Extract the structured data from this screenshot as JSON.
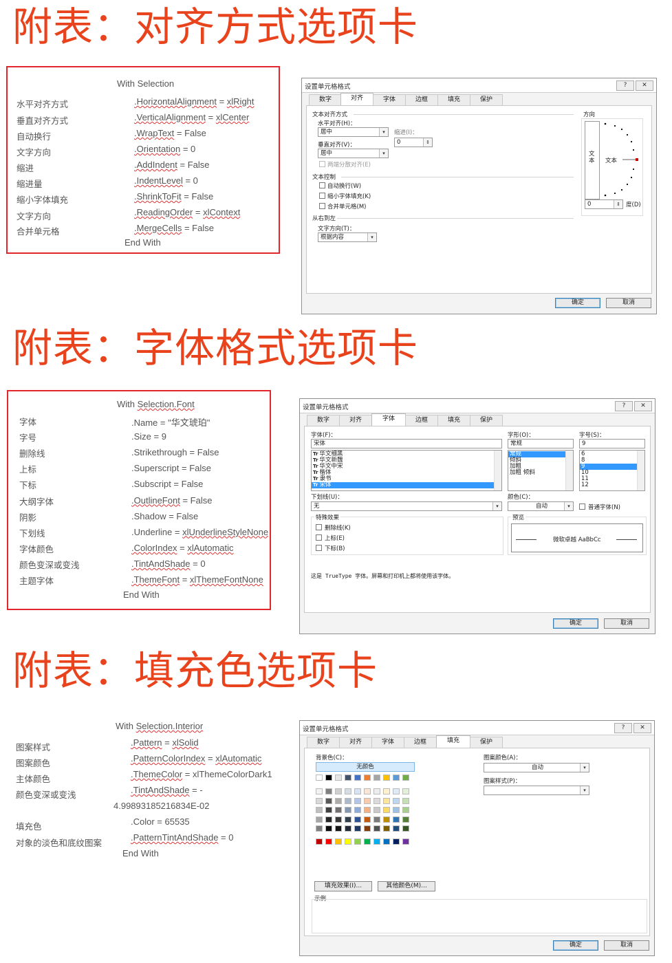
{
  "sections": [
    {
      "title": "附表：对齐方式选项卡",
      "code": {
        "with": "With Selection",
        "end": "End With",
        "rows": [
          {
            "label": "水平对齐方式",
            "prop": ".HorizontalAlignment",
            "rest": " = ",
            "val": "xlRight"
          },
          {
            "label": "垂直对齐方式",
            "prop": ".VerticalAlignment",
            "rest": " = ",
            "val": "xlCenter"
          },
          {
            "label": "自动换行",
            "prop": ".WrapText",
            "rest": " = False",
            "val": ""
          },
          {
            "label": "文字方向",
            "prop": ".Orientation",
            "rest": " = 0",
            "val": ""
          },
          {
            "label": "缩进",
            "prop": ".AddIndent",
            "rest": " = False",
            "val": ""
          },
          {
            "label": "缩进量",
            "prop": ".IndentLevel",
            "rest": " = 0",
            "val": ""
          },
          {
            "label": "缩小字体填充",
            "prop": ".ShrinkToFit",
            "rest": " = False",
            "val": ""
          },
          {
            "label": "文字方向",
            "prop": ".ReadingOrder",
            "rest": " = ",
            "val": "xlContext"
          },
          {
            "label": "合并单元格",
            "prop": ".MergeCells",
            "rest": " = False",
            "val": ""
          }
        ]
      }
    },
    {
      "title": "附表：字体格式选项卡",
      "code": {
        "with_prefix": "With ",
        "with_obj": "Selection.Font",
        "end": "End With",
        "rows": [
          {
            "label": "字体",
            "prop": ".Name",
            "rest": " = \"华文琥珀\"",
            "val": ""
          },
          {
            "label": "字号",
            "prop": ".Size",
            "rest": " = 9",
            "val": ""
          },
          {
            "label": "删除线",
            "prop": ".Strikethrough",
            "rest": " = False",
            "val": ""
          },
          {
            "label": "上标",
            "prop": ".Superscript",
            "rest": " = False",
            "val": ""
          },
          {
            "label": "下标",
            "prop": ".Subscript",
            "rest": " = False",
            "val": ""
          },
          {
            "label": "大纲字体",
            "prop": ".OutlineFont",
            "rest": " = False",
            "val": ""
          },
          {
            "label": "阴影",
            "prop": ".Shadow",
            "rest": " = False",
            "val": ""
          },
          {
            "label": "下划线",
            "prop": ".Underline",
            "rest": " = ",
            "val": "xlUnderlineStyleNone"
          },
          {
            "label": "字体颜色",
            "prop": ".ColorIndex",
            "rest": " = ",
            "val": "xlAutomatic"
          },
          {
            "label": "颜色变深或变浅",
            "prop": ".TintAndShade",
            "rest": " = 0",
            "val": ""
          },
          {
            "label": "主题字体",
            "prop": ".ThemeFont",
            "rest": " = ",
            "val": "xlThemeFontNone"
          }
        ]
      }
    },
    {
      "title": "附表：填充色选项卡",
      "code": {
        "with_prefix": "With ",
        "with_obj": "Selection.Interior",
        "end": "End With",
        "labels": [
          "图案样式",
          "图案颜色",
          "主体颜色",
          "颜色变深或变浅",
          "填充色",
          "对象的淡色和底纹图案"
        ],
        "rows": [
          {
            "prop": ".Pattern",
            "rest": " = ",
            "val": "xlSolid"
          },
          {
            "prop": ".PatternColorIndex",
            "rest": " = ",
            "val": "xlAutomatic"
          },
          {
            "prop": ".ThemeColor",
            "rest": " = xlThemeColorDark1",
            "val": ""
          },
          {
            "prop": ".TintAndShade",
            "rest": " = -",
            "val": ""
          },
          {
            "prop": "",
            "rest": "4.99893185216834E-02",
            "val": ""
          },
          {
            "prop": ".Color",
            "rest": " = 65535",
            "val": ""
          },
          {
            "prop": ".PatternTintAndShade",
            "rest": " = 0",
            "val": ""
          }
        ]
      }
    }
  ],
  "dialog": {
    "title": "设置单元格格式",
    "help": "?",
    "close": "✕",
    "tabs": [
      "数字",
      "对齐",
      "字体",
      "边框",
      "填充",
      "保护"
    ],
    "ok": "确定",
    "cancel": "取消",
    "align": {
      "group_text_align": "文本对齐方式",
      "horizontal_label": "水平对齐(H)：",
      "horizontal_value": "居中",
      "indent_label": "缩进(I)：",
      "indent_value": "0",
      "vertical_label": "垂直对齐(V)：",
      "vertical_value": "居中",
      "justify_distributed": "两端分散对齐(E)",
      "group_text_control": "文本控制",
      "wrap": "自动换行(W)",
      "shrink": "缩小字体填充(K)",
      "merge": "合并单元格(M)",
      "group_rtl": "从右到左",
      "direction_label": "文字方向(T)：",
      "direction_value": "根据内容",
      "orientation": "方向",
      "vertical_text": "文本",
      "horizontal_text": "文本",
      "degree_value": "0",
      "degree_label": "度(D)"
    },
    "font": {
      "font_label": "字体(F)：",
      "font_value": "宋体",
      "font_list": [
        "华文细黑",
        "华文新魏",
        "华文中宋",
        "楷体",
        "隶书",
        "宋体"
      ],
      "style_label": "字形(O)：",
      "style_value": "常规",
      "style_list": [
        "常规",
        "倾斜",
        "加粗",
        "加粗 倾斜"
      ],
      "size_label": "字号(S)：",
      "size_value": "9",
      "size_list": [
        "6",
        "8",
        "9",
        "10",
        "11",
        "12"
      ],
      "underline_label": "下划线(U)：",
      "underline_value": "无",
      "color_label": "颜色(C)：",
      "color_value": "自动",
      "normal_font": "普通字体(N)",
      "effects_label": "特殊效果",
      "strike": "删除线(K)",
      "super": "上标(E)",
      "sub": "下标(B)",
      "preview_label": "预览",
      "preview_text": "微软卓越  AaBbCc",
      "note": "这是 TrueType 字体。屏幕和打印机上都将使用该字体。"
    },
    "fill": {
      "bg_label": "背景色(C)：",
      "no_color": "无颜色",
      "fill_effects": "填充效果(I)...",
      "more_colors": "其他颜色(M)...",
      "pattern_color_label": "图案颜色(A)：",
      "pattern_color_value": "自动",
      "pattern_style_label": "图案样式(P)：",
      "sample_label": "示例",
      "theme_row": [
        "#ffffff",
        "#000000",
        "#e7e6e6",
        "#44546a",
        "#4472c4",
        "#ed7d31",
        "#a5a5a5",
        "#ffc000",
        "#5b9bd5",
        "#70ad47"
      ],
      "tint_rows": [
        [
          "#f2f2f2",
          "#808080",
          "#d0cece",
          "#d6dce4",
          "#d9e2f3",
          "#fbe5d5",
          "#ededed",
          "#fff2cc",
          "#deebf6",
          "#e2efd9"
        ],
        [
          "#d9d9d9",
          "#595959",
          "#aeabab",
          "#adb9ca",
          "#b4c6e7",
          "#f7cbac",
          "#dbdbdb",
          "#fee599",
          "#bdd7ee",
          "#c5e0b3"
        ],
        [
          "#bfbfbf",
          "#404040",
          "#757070",
          "#8496b0",
          "#8eaadb",
          "#f4b183",
          "#c9c9c9",
          "#ffd965",
          "#9cc3e5",
          "#a8d08d"
        ],
        [
          "#a6a6a6",
          "#262626",
          "#3a3838",
          "#323f4f",
          "#2f5496",
          "#c55a11",
          "#7b7b7b",
          "#bf8f00",
          "#2e75b5",
          "#538135"
        ],
        [
          "#808080",
          "#0d0d0d",
          "#171616",
          "#222a35",
          "#1f3864",
          "#833c0b",
          "#525252",
          "#7f6000",
          "#1e4e79",
          "#375623"
        ]
      ],
      "standard_row": [
        "#c00000",
        "#ff0000",
        "#ffc000",
        "#ffff00",
        "#92d050",
        "#00b050",
        "#00b0f0",
        "#0070c0",
        "#002060",
        "#7030a0"
      ]
    }
  }
}
